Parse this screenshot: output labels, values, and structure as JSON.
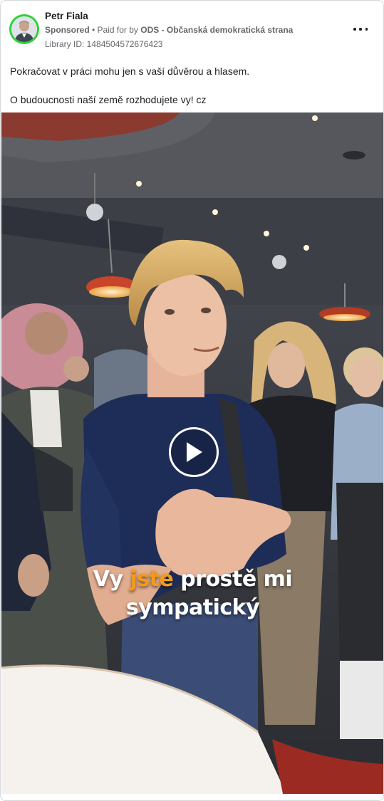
{
  "post": {
    "author": "Petr Fiala",
    "sponsored_label": "Sponsored",
    "separator": " • ",
    "paid_for_prefix": "Paid for by ",
    "paid_for_by": "ODS - Občanská demokratická strana",
    "library_id": "Library ID: 1484504572676423",
    "body_line1": "Pokračovat v práci mohu jen s vaší důvěrou a hlasem.",
    "body_line2": "O budoucnosti naší země rozhodujete vy! cz"
  },
  "video": {
    "caption_line1_part1": "Vy ",
    "caption_line1_accent": "jste",
    "caption_line1_part2": " prostě mi",
    "caption_line2": "sympatický"
  },
  "icons": {
    "more": "more-options-icon",
    "play": "play-icon",
    "avatar": "avatar"
  },
  "colors": {
    "avatar_ring": "#2fd13a",
    "caption_accent": "#f39a1d",
    "text_primary": "#1c1e21",
    "text_secondary": "#65676b"
  }
}
